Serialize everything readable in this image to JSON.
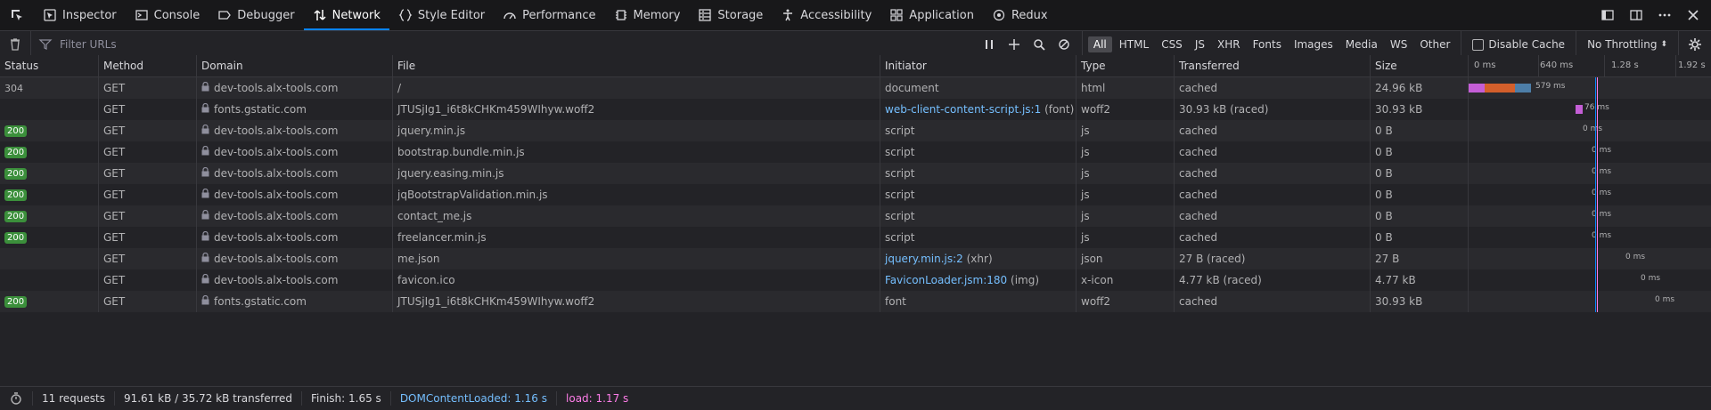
{
  "toolbar": {
    "tabs": [
      {
        "label": "Inspector",
        "icon": "inspector-icon"
      },
      {
        "label": "Console",
        "icon": "console-icon"
      },
      {
        "label": "Debugger",
        "icon": "debugger-icon"
      },
      {
        "label": "Network",
        "icon": "network-icon",
        "active": true
      },
      {
        "label": "Style Editor",
        "icon": "style-editor-icon"
      },
      {
        "label": "Performance",
        "icon": "performance-icon"
      },
      {
        "label": "Memory",
        "icon": "memory-icon"
      },
      {
        "label": "Storage",
        "icon": "storage-icon"
      },
      {
        "label": "Accessibility",
        "icon": "accessibility-icon"
      },
      {
        "label": "Application",
        "icon": "application-icon"
      },
      {
        "label": "Redux",
        "icon": "redux-icon"
      }
    ]
  },
  "filter": {
    "placeholder": "Filter URLs",
    "types": [
      "All",
      "HTML",
      "CSS",
      "JS",
      "XHR",
      "Fonts",
      "Images",
      "Media",
      "WS",
      "Other"
    ],
    "selected": "All",
    "disable_cache": "Disable Cache",
    "throttling": "No Throttling"
  },
  "columns": {
    "status": "Status",
    "method": "Method",
    "domain": "Domain",
    "file": "File",
    "initiator": "Initiator",
    "type": "Type",
    "transferred": "Transferred",
    "size": "Size"
  },
  "waterfall_ticks": [
    "0 ms",
    "640 ms",
    "1.28 s",
    "1.92 s"
  ],
  "rows": [
    {
      "status": "304",
      "method": "GET",
      "domain": "dev-tools.alx-tools.com",
      "file": "/",
      "initiator": "document",
      "initiator_link": "",
      "type": "html",
      "transferred": "cached",
      "size": "24.96 kB",
      "timing": "579 ms"
    },
    {
      "status": "",
      "method": "GET",
      "domain": "fonts.gstatic.com",
      "file": "JTUSjIg1_i6t8kCHKm459WIhyw.woff2",
      "initiator": "(font)",
      "initiator_link": "web-client-content-script.js:1",
      "type": "woff2",
      "transferred": "30.93 kB (raced)",
      "size": "30.93 kB",
      "timing": "76 ms"
    },
    {
      "status": "200",
      "method": "GET",
      "domain": "dev-tools.alx-tools.com",
      "file": "jquery.min.js",
      "initiator": "script",
      "initiator_link": "",
      "type": "js",
      "transferred": "cached",
      "size": "0 B",
      "timing": "0 ms"
    },
    {
      "status": "200",
      "method": "GET",
      "domain": "dev-tools.alx-tools.com",
      "file": "bootstrap.bundle.min.js",
      "initiator": "script",
      "initiator_link": "",
      "type": "js",
      "transferred": "cached",
      "size": "0 B",
      "timing": "0 ms"
    },
    {
      "status": "200",
      "method": "GET",
      "domain": "dev-tools.alx-tools.com",
      "file": "jquery.easing.min.js",
      "initiator": "script",
      "initiator_link": "",
      "type": "js",
      "transferred": "cached",
      "size": "0 B",
      "timing": "0 ms"
    },
    {
      "status": "200",
      "method": "GET",
      "domain": "dev-tools.alx-tools.com",
      "file": "jqBootstrapValidation.min.js",
      "initiator": "script",
      "initiator_link": "",
      "type": "js",
      "transferred": "cached",
      "size": "0 B",
      "timing": "0 ms"
    },
    {
      "status": "200",
      "method": "GET",
      "domain": "dev-tools.alx-tools.com",
      "file": "contact_me.js",
      "initiator": "script",
      "initiator_link": "",
      "type": "js",
      "transferred": "cached",
      "size": "0 B",
      "timing": "0 ms"
    },
    {
      "status": "200",
      "method": "GET",
      "domain": "dev-tools.alx-tools.com",
      "file": "freelancer.min.js",
      "initiator": "script",
      "initiator_link": "",
      "type": "js",
      "transferred": "cached",
      "size": "0 B",
      "timing": "0 ms"
    },
    {
      "status": "",
      "method": "GET",
      "domain": "dev-tools.alx-tools.com",
      "file": "me.json",
      "initiator": "(xhr)",
      "initiator_link": "jquery.min.js:2",
      "type": "json",
      "transferred": "27 B (raced)",
      "size": "27 B",
      "timing": "0 ms"
    },
    {
      "status": "",
      "method": "GET",
      "domain": "dev-tools.alx-tools.com",
      "file": "favicon.ico",
      "initiator": "(img)",
      "initiator_link": "FaviconLoader.jsm:180",
      "type": "x-icon",
      "transferred": "4.77 kB (raced)",
      "size": "4.77 kB",
      "timing": "0 ms"
    },
    {
      "status": "200",
      "method": "GET",
      "domain": "fonts.gstatic.com",
      "file": "JTUSjIg1_i6t8kCHKm459WIhyw.woff2",
      "initiator": "font",
      "initiator_link": "",
      "type": "woff2",
      "transferred": "cached",
      "size": "30.93 kB",
      "timing": "0 ms"
    }
  ],
  "status_bar": {
    "requests": "11 requests",
    "transferred": "91.61 kB / 35.72 kB transferred",
    "finish": "Finish: 1.65 s",
    "dom_content_loaded": "DOMContentLoaded: 1.16 s",
    "load": "load: 1.17 s"
  },
  "colors": {
    "accent": "#0a84ff",
    "status_ok": "#3b8f3b",
    "link": "#75bfff",
    "load": "#ff7de9",
    "bar_blocked": "#c45ed6",
    "bar_connect": "#d35f2b",
    "bar_wait": "#4d7ea8"
  }
}
